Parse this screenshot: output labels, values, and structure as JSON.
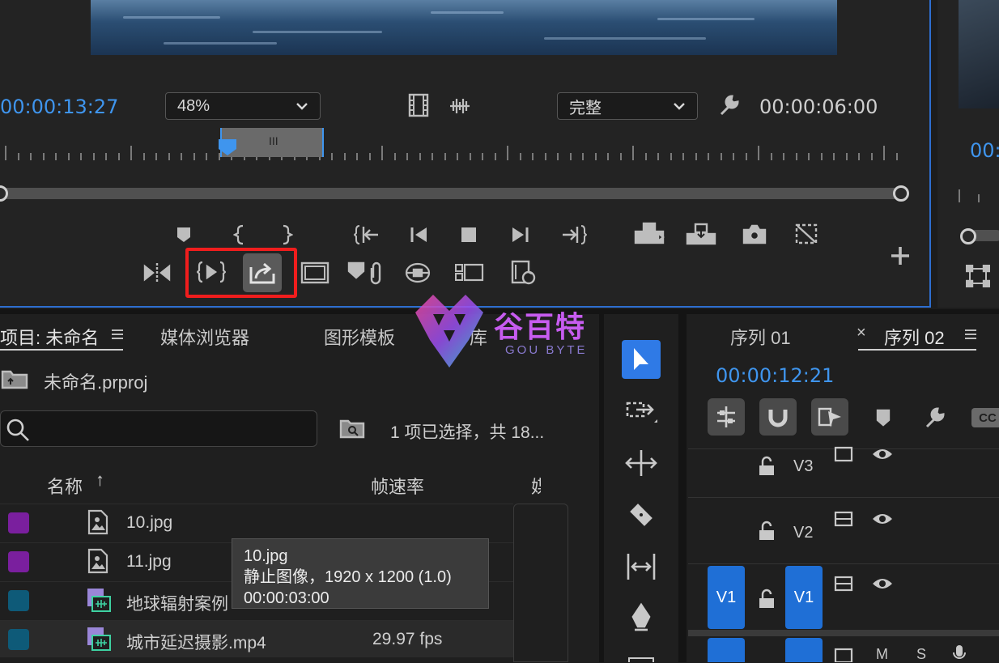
{
  "program": {
    "timecode_current": "00:00:13:27",
    "zoom": "48%",
    "quality": "完整",
    "timecode_duration": "00:00:06:00",
    "zoom_bar_mark": "III"
  },
  "source": {
    "timecode": "00:"
  },
  "project": {
    "tabs": [
      "项目: 未命名",
      "媒体浏览器",
      "图形模板",
      "库"
    ],
    "file_name": "未命名.prproj",
    "search_placeholder": "",
    "selection_status": "1 项已选择，共 18...",
    "col_name": "名称",
    "col_name_sort": "↑",
    "col_fps": "帧速率",
    "col_more": "媒",
    "rows": [
      {
        "name": "10.jpg",
        "fps": "",
        "color": "#7a1f9e"
      },
      {
        "name": "11.jpg",
        "fps": "",
        "color": "#7a1f9e"
      },
      {
        "name": "地球辐射案例",
        "fps": "",
        "color": "#0e5a78"
      },
      {
        "name": "城市延迟摄影.mp4",
        "fps": "29.97 fps",
        "color": "#0e5a78"
      }
    ],
    "tooltip": {
      "line1": "10.jpg",
      "line2": "静止图像，1920 x 1200 (1.0)",
      "line3": "00:00:03:00"
    }
  },
  "timeline": {
    "tabs": [
      "序列 01",
      "序列 02"
    ],
    "close": "×",
    "timecode": "00:00:12:21",
    "tracks": [
      "V3",
      "V2",
      "V1"
    ],
    "v1_source": "V1",
    "audio_labels": [
      "M",
      "S"
    ],
    "cc": "CC"
  },
  "watermark": {
    "text": "谷百特",
    "sub": "GOU BYTE"
  },
  "colors": {
    "accent": "#3f95ee",
    "highlight": "#f01d1d",
    "track_blue": "#1f6fd6"
  }
}
